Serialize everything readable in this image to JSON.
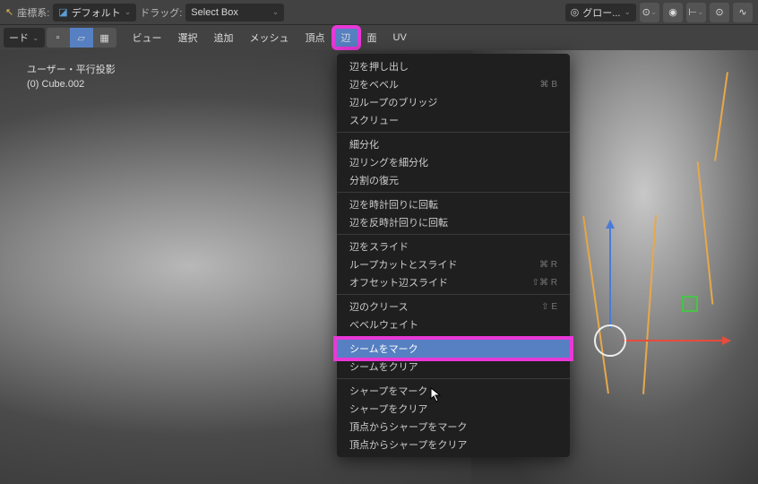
{
  "top_bar": {
    "coord_label": "座標系:",
    "coord_value": "デフォルト",
    "drag_label": "ドラッグ:",
    "drag_value": "Select Box",
    "snap_label": "グロー..."
  },
  "second_bar": {
    "mode_value": "ード",
    "menus": {
      "view": "ビュー",
      "select": "選択",
      "add": "追加",
      "mesh": "メッシュ",
      "vertex": "頂点",
      "edge": "辺",
      "face": "面",
      "uv": "UV"
    }
  },
  "info": {
    "line1": "ユーザー・平行投影",
    "line2": "(0) Cube.002"
  },
  "context_menu": {
    "items": [
      {
        "label": "辺を押し出し",
        "shortcut": ""
      },
      {
        "label": "辺をベベル",
        "shortcut": "⌘ B"
      },
      {
        "label": "辺ループのブリッジ",
        "shortcut": ""
      },
      {
        "label": "スクリュー",
        "shortcut": ""
      },
      {
        "sep": true
      },
      {
        "label": "細分化",
        "shortcut": ""
      },
      {
        "label": "辺リングを細分化",
        "shortcut": ""
      },
      {
        "label": "分割の復元",
        "shortcut": ""
      },
      {
        "sep": true
      },
      {
        "label": "辺を時計回りに回転",
        "shortcut": ""
      },
      {
        "label": "辺を反時計回りに回転",
        "shortcut": ""
      },
      {
        "sep": true
      },
      {
        "label": "辺をスライド",
        "shortcut": ""
      },
      {
        "label": "ループカットとスライド",
        "shortcut": "⌘ R"
      },
      {
        "label": "オフセット辺スライド",
        "shortcut": "⇧⌘ R"
      },
      {
        "sep": true
      },
      {
        "label": "辺のクリース",
        "shortcut": "⇧ E"
      },
      {
        "label": "べベルウェイト",
        "shortcut": ""
      },
      {
        "sep": true
      },
      {
        "label": "シームをマーク",
        "shortcut": "",
        "hovered": true
      },
      {
        "label": "シームをクリア",
        "shortcut": ""
      },
      {
        "sep": true
      },
      {
        "label": "シャープをマーク",
        "shortcut": ""
      },
      {
        "label": "シャープをクリア",
        "shortcut": ""
      },
      {
        "label": "頂点からシャープをマーク",
        "shortcut": ""
      },
      {
        "label": "頂点からシャープをクリア",
        "shortcut": ""
      }
    ]
  }
}
